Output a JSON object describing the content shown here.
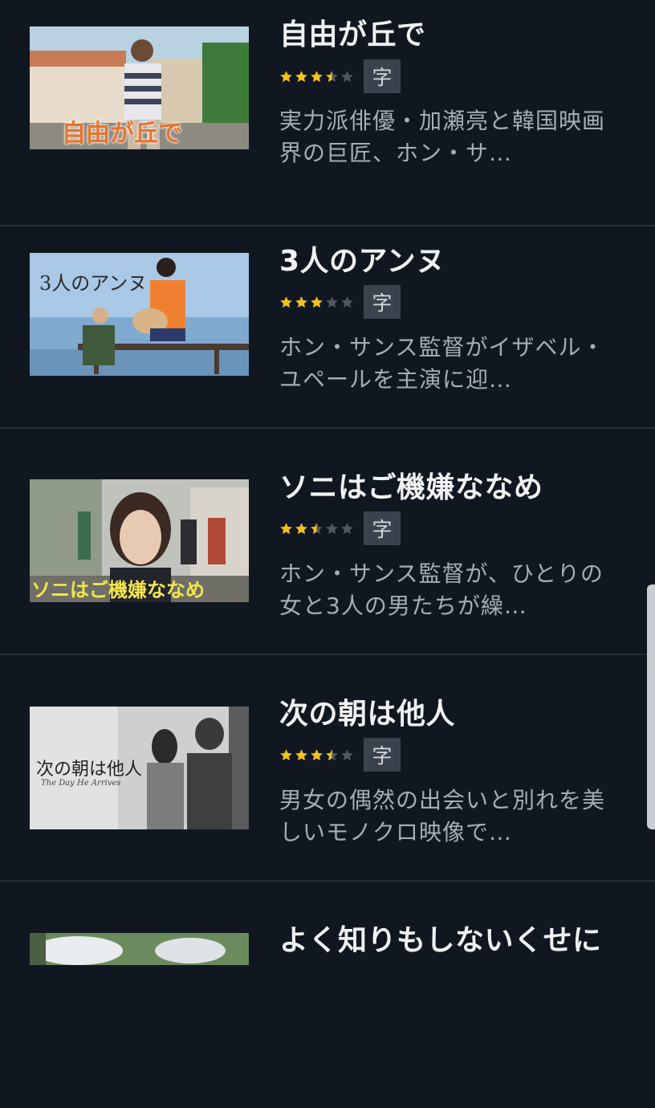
{
  "items": [
    {
      "title": "自由が丘で",
      "rating": 3.5,
      "badge": "字",
      "description": "実力派俳優・加瀬亮と韓国映画界の巨匠、ホン・サ…",
      "poster_text": "自由が丘で"
    },
    {
      "title": "3人のアンヌ",
      "rating": 3.0,
      "badge": "字",
      "description": "ホン・サンス監督がイザベル・ユペールを主演に迎…",
      "poster_text": "3人のアンヌ"
    },
    {
      "title": "ソニはご機嫌ななめ",
      "rating": 2.5,
      "badge": "字",
      "description": "ホン・サンス監督が、ひとりの女と3人の男たちが繰…",
      "poster_text": "ソニはご機嫌ななめ"
    },
    {
      "title": "次の朝は他人",
      "rating": 3.5,
      "badge": "字",
      "description": "男女の偶然の出会いと別れを美しいモノクロ映像で…",
      "poster_text": "次の朝は他人",
      "poster_subtext": "The Day He Arrives"
    },
    {
      "title": "よく知りもしないくせに",
      "rating": null,
      "badge": "",
      "description": ""
    }
  ],
  "colors": {
    "background": "#101720",
    "star_on": "#f2c21b",
    "star_off": "#4f5660",
    "badge_bg": "#3a434d"
  }
}
